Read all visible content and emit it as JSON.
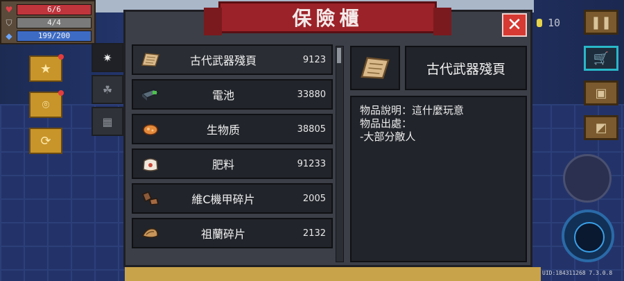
{
  "hud": {
    "hp": "6/6",
    "armor": "4/4",
    "energy": "199/200",
    "coins": "10",
    "uid": "UID:184311268  7.3.0.8"
  },
  "icons": {
    "hp": "heart-icon",
    "armor": "shield-icon",
    "energy": "diamond-icon",
    "pause": "pause-icon",
    "shop": "cart-icon",
    "profile": "profile-card-icon",
    "map": "exit-stairs-icon",
    "close": "close-x-icon"
  },
  "window": {
    "title": "保險櫃",
    "close_label": "✕"
  },
  "tabs": [
    {
      "name": "materials",
      "glyph": "✷",
      "active": true
    },
    {
      "name": "seeds",
      "glyph": "☘",
      "active": false
    },
    {
      "name": "tickets",
      "glyph": "▦",
      "active": false
    }
  ],
  "items": [
    {
      "name": "古代武器殘頁",
      "qty": "9123",
      "icon": "parchment-icon"
    },
    {
      "name": "電池",
      "qty": "33880",
      "icon": "battery-icon"
    },
    {
      "name": "生物质",
      "qty": "38805",
      "icon": "biomass-icon"
    },
    {
      "name": "肥料",
      "qty": "91233",
      "icon": "fertilizer-bag-icon"
    },
    {
      "name": "維C機甲碎片",
      "qty": "2005",
      "icon": "mech-fragment-icon"
    },
    {
      "name": "祖蘭碎片",
      "qty": "2132",
      "icon": "zulan-fragment-icon"
    }
  ],
  "detail": {
    "name": "古代武器殘頁",
    "desc_line1": "物品說明：這什麼玩意",
    "desc_line2": "物品出處：",
    "desc_line3": "-大部分敵人"
  },
  "colors": {
    "banner": "#9b2228",
    "close": "#d63a32",
    "panel": "#3c3f47",
    "slot": "#21242a"
  }
}
